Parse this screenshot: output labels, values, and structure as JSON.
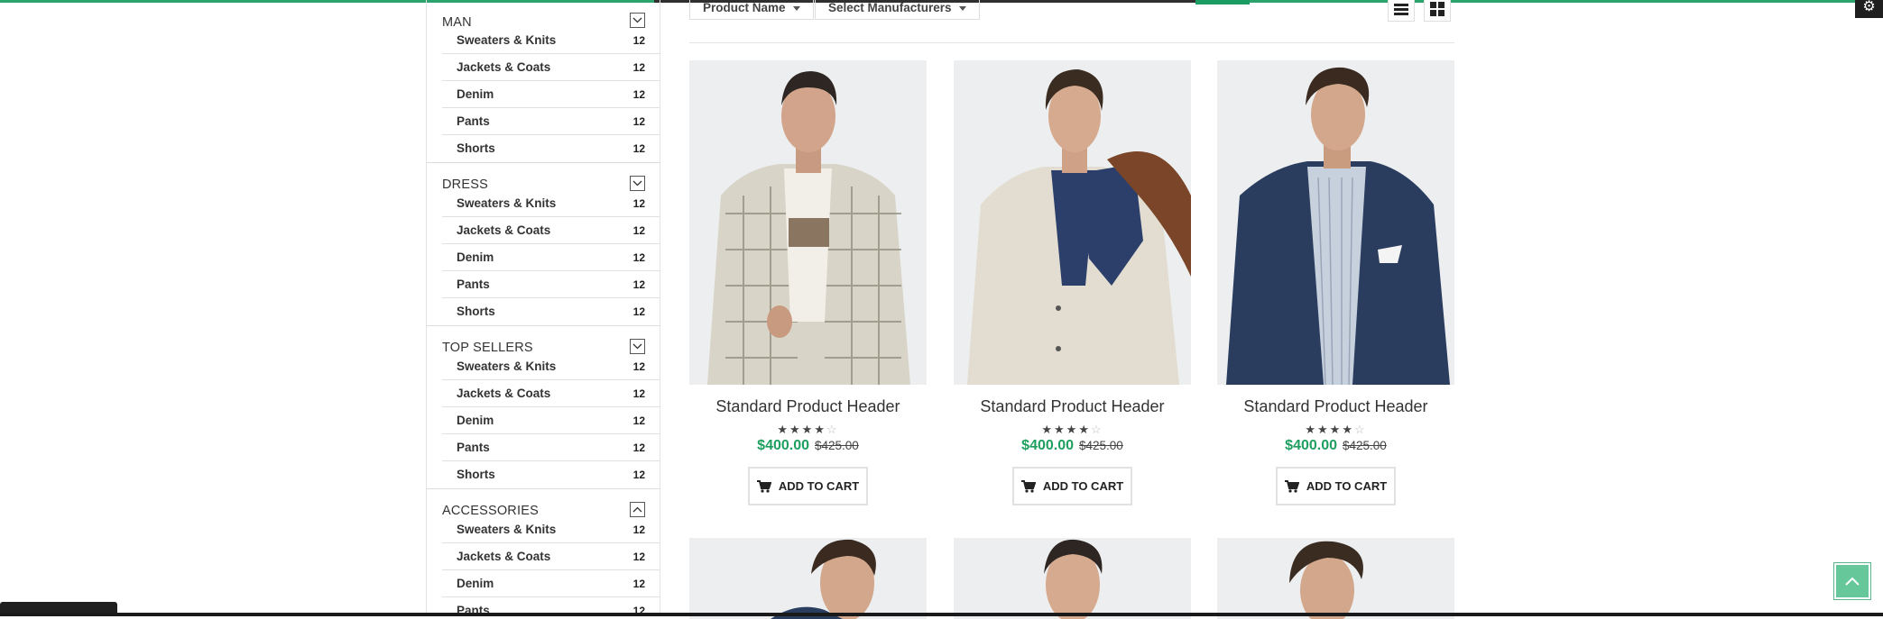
{
  "sidebar": {
    "categories": [
      {
        "name": "MAN",
        "toggle": "collapse",
        "items": [
          {
            "label": "Sweaters & Knits",
            "count": "12"
          },
          {
            "label": "Jackets & Coats",
            "count": "12"
          },
          {
            "label": "Denim",
            "count": "12"
          },
          {
            "label": "Pants",
            "count": "12"
          },
          {
            "label": "Shorts",
            "count": "12"
          }
        ]
      },
      {
        "name": "DRESS",
        "toggle": "collapse",
        "items": [
          {
            "label": "Sweaters & Knits",
            "count": "12"
          },
          {
            "label": "Jackets & Coats",
            "count": "12"
          },
          {
            "label": "Denim",
            "count": "12"
          },
          {
            "label": "Pants",
            "count": "12"
          },
          {
            "label": "Shorts",
            "count": "12"
          }
        ]
      },
      {
        "name": "TOP SELLERS",
        "toggle": "collapse",
        "items": [
          {
            "label": "Sweaters & Knits",
            "count": "12"
          },
          {
            "label": "Jackets & Coats",
            "count": "12"
          },
          {
            "label": "Denim",
            "count": "12"
          },
          {
            "label": "Pants",
            "count": "12"
          },
          {
            "label": "Shorts",
            "count": "12"
          }
        ]
      },
      {
        "name": "ACCESSORIES",
        "toggle": "expand",
        "items": [
          {
            "label": "Sweaters & Knits",
            "count": "12"
          },
          {
            "label": "Jackets & Coats",
            "count": "12"
          },
          {
            "label": "Denim",
            "count": "12"
          },
          {
            "label": "Pants",
            "count": "12"
          }
        ]
      }
    ]
  },
  "toolbar": {
    "sort_label": "Product Name",
    "manufacturer_label": "Select Manufacturers",
    "view_icons": [
      "list-view-icon",
      "grid-view-icon"
    ]
  },
  "products": [
    {
      "title": "Standard Product Header",
      "price": "$400.00",
      "old_price": "$425.00",
      "rating": 4,
      "rating_max": 5,
      "cart_label": "ADD TO CART",
      "image": "plaid-blazer-model"
    },
    {
      "title": "Standard Product Header",
      "price": "$400.00",
      "old_price": "$425.00",
      "rating": 4,
      "rating_max": 5,
      "cart_label": "ADD TO CART",
      "image": "cream-blazer-model"
    },
    {
      "title": "Standard Product Header",
      "price": "$400.00",
      "old_price": "$425.00",
      "rating": 4,
      "rating_max": 5,
      "cart_label": "ADD TO CART",
      "image": "navy-blazer-model"
    }
  ],
  "colors": {
    "accent": "#2ca36e",
    "price": "#1f9f5f",
    "scroll_top_button": "#66c79b"
  }
}
